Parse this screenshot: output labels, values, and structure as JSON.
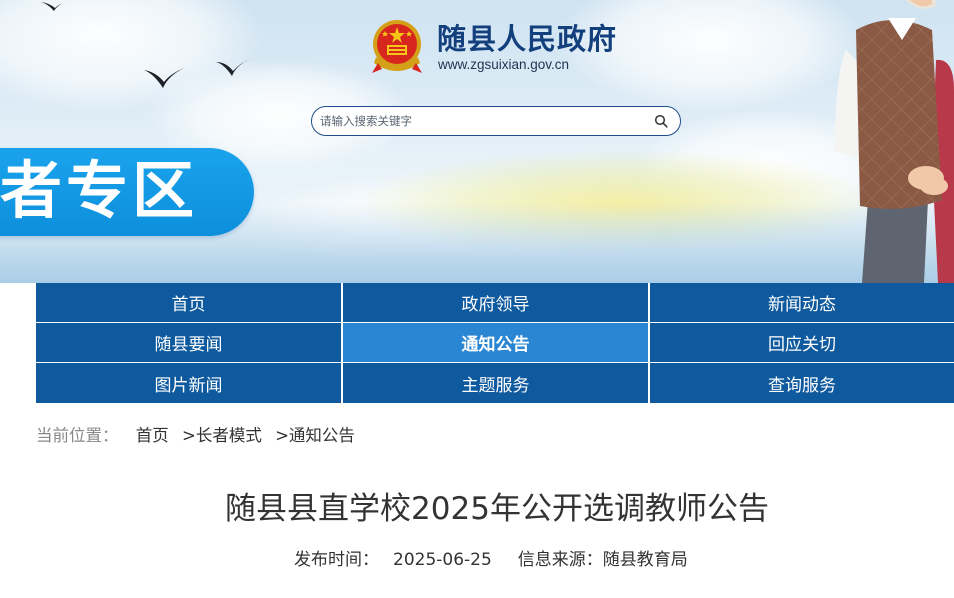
{
  "header": {
    "site_title": "随县人民政府",
    "site_url": "www.zgsuixian.gov.cn",
    "zone_tag": "者专区",
    "emblem_icon": "national-emblem-icon"
  },
  "search": {
    "placeholder": "请输入搜索关键字",
    "icon": "search-icon"
  },
  "nav": {
    "items": [
      {
        "label": "首页"
      },
      {
        "label": "政府领导"
      },
      {
        "label": "新闻动态"
      },
      {
        "label": "随县要闻"
      },
      {
        "label": "通知公告"
      },
      {
        "label": "回应关切"
      },
      {
        "label": "图片新闻"
      },
      {
        "label": "主题服务"
      },
      {
        "label": "查询服务"
      }
    ],
    "active_label": "通知公告"
  },
  "breadcrumb": {
    "label": "当前位置：",
    "items": [
      "首页",
      "长者模式",
      "通知公告"
    ],
    "separator": ">"
  },
  "article": {
    "title": "随县县直学校2025年公开选调教师公告",
    "publish_label": "发布时间：",
    "publish_date": "2025-06-25",
    "source_label": "信息来源：",
    "source": "随县教育局"
  },
  "colors": {
    "nav_bg": "#0f5a9e",
    "nav_active": "#2a86d2",
    "title_blue": "#133f7d",
    "zone_blue": "#0d8fdc"
  }
}
